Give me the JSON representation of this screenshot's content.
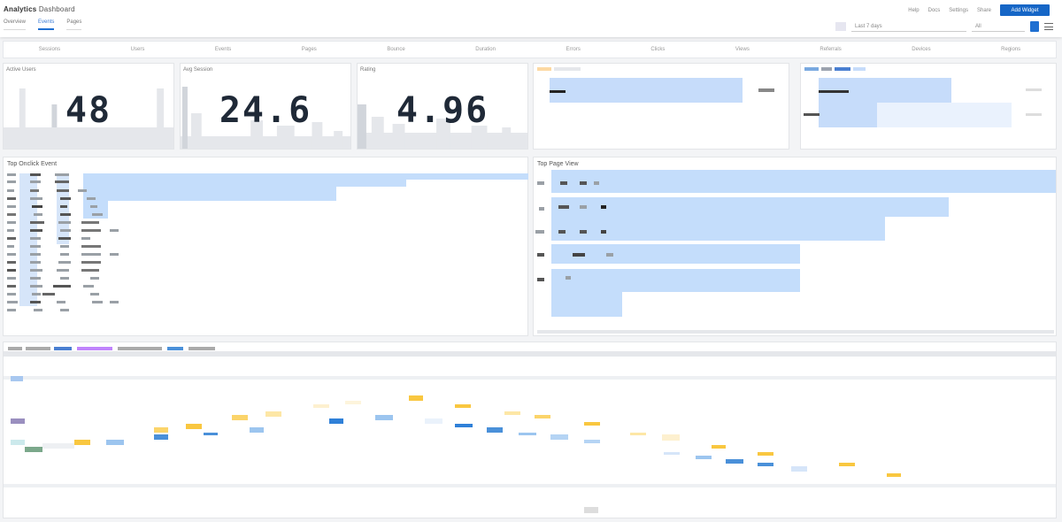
{
  "header": {
    "brand_left": "Analytics",
    "brand_right": "Dashboard",
    "tabs": [
      "Overview",
      "Events",
      "Pages"
    ],
    "links": [
      "Help",
      "Docs",
      "Settings",
      "Share"
    ],
    "primary_button": "Add Widget",
    "filter_placeholder": "Last 7 days",
    "filter_small": "All"
  },
  "strip": {
    "items": [
      "Sessions",
      "Users",
      "Events",
      "Pages",
      "Bounce",
      "Duration",
      "Errors",
      "Clicks",
      "Views",
      "Referrals",
      "Devices",
      "Regions"
    ]
  },
  "stats": [
    {
      "label": "Active Users",
      "value": "48"
    },
    {
      "label": "Avg Session",
      "value": "24.6"
    },
    {
      "label": "Rating",
      "value": "4.96"
    }
  ],
  "panels": {
    "top_onclick": {
      "title": "Top Onclick Event"
    },
    "top_pageview": {
      "title": "Top Page View"
    }
  },
  "colors": {
    "accent": "#1666c6",
    "bar": "#c4ddfb",
    "yellow": "#f9c740",
    "blue": "#4a90d9"
  }
}
